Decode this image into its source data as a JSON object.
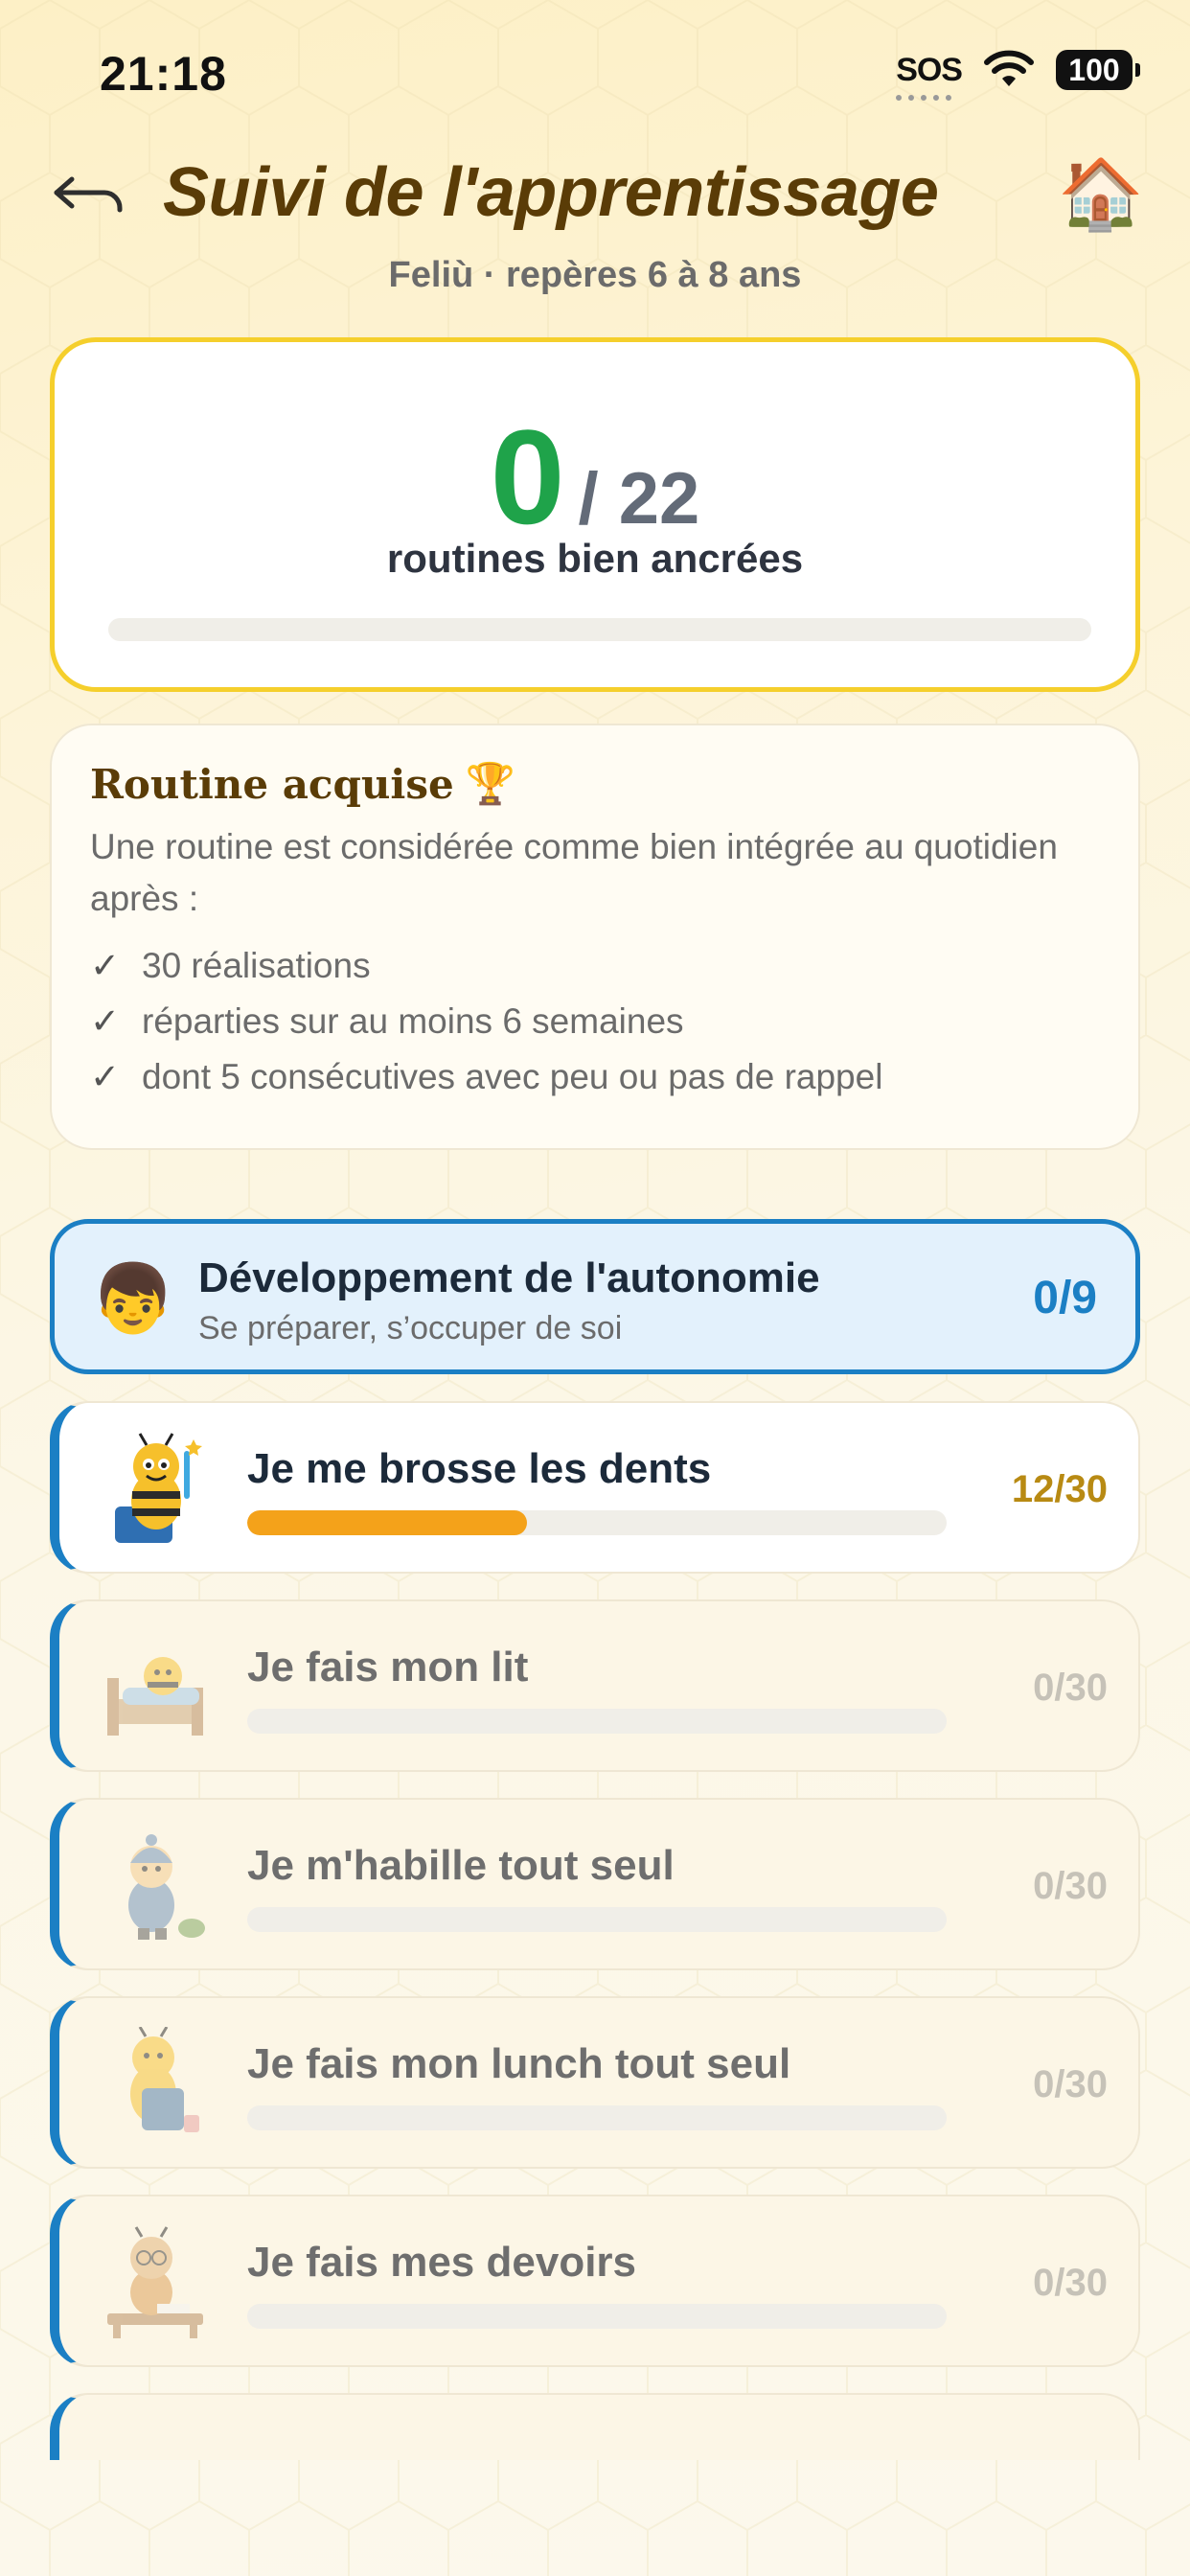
{
  "status_bar": {
    "time": "21:18",
    "sos": "SOS",
    "battery": "100"
  },
  "header": {
    "title": "Suivi de l'apprentissage",
    "subtitle": "Feliù · repères 6 à 8 ans",
    "home_icon": "🏠"
  },
  "score": {
    "value": "0",
    "total": "/ 22",
    "caption": "routines bien ancrées",
    "progress_fraction": 0
  },
  "info": {
    "title": "Routine acquise",
    "title_icon": "🏆",
    "text": "Une routine est considérée comme bien intégrée au quotidien après :",
    "criteria": [
      "30 réalisations",
      "réparties sur au moins 6 semaines",
      "dont 5 consécutives avec peu ou pas de rappel"
    ]
  },
  "category": {
    "emoji": "👦",
    "title": "Développement de l'autonomie",
    "subtitle": "Se préparer, s’occuper de soi",
    "count": "0/9",
    "accent": "#1b7fc4"
  },
  "routines": [
    {
      "title": "Je me brosse les dents",
      "count": "12/30",
      "progress": 0.4
    },
    {
      "title": "Je fais mon lit",
      "count": "0/30",
      "progress": 0
    },
    {
      "title": "Je m'habille tout seul",
      "count": "0/30",
      "progress": 0
    },
    {
      "title": "Je fais mon lunch tout seul",
      "count": "0/30",
      "progress": 0
    },
    {
      "title": "Je fais mes devoirs",
      "count": "0/30",
      "progress": 0
    }
  ],
  "colors": {
    "progress_active": "#f4a21a",
    "score_green": "#1fa34a",
    "title_brown": "#5a3c07"
  }
}
